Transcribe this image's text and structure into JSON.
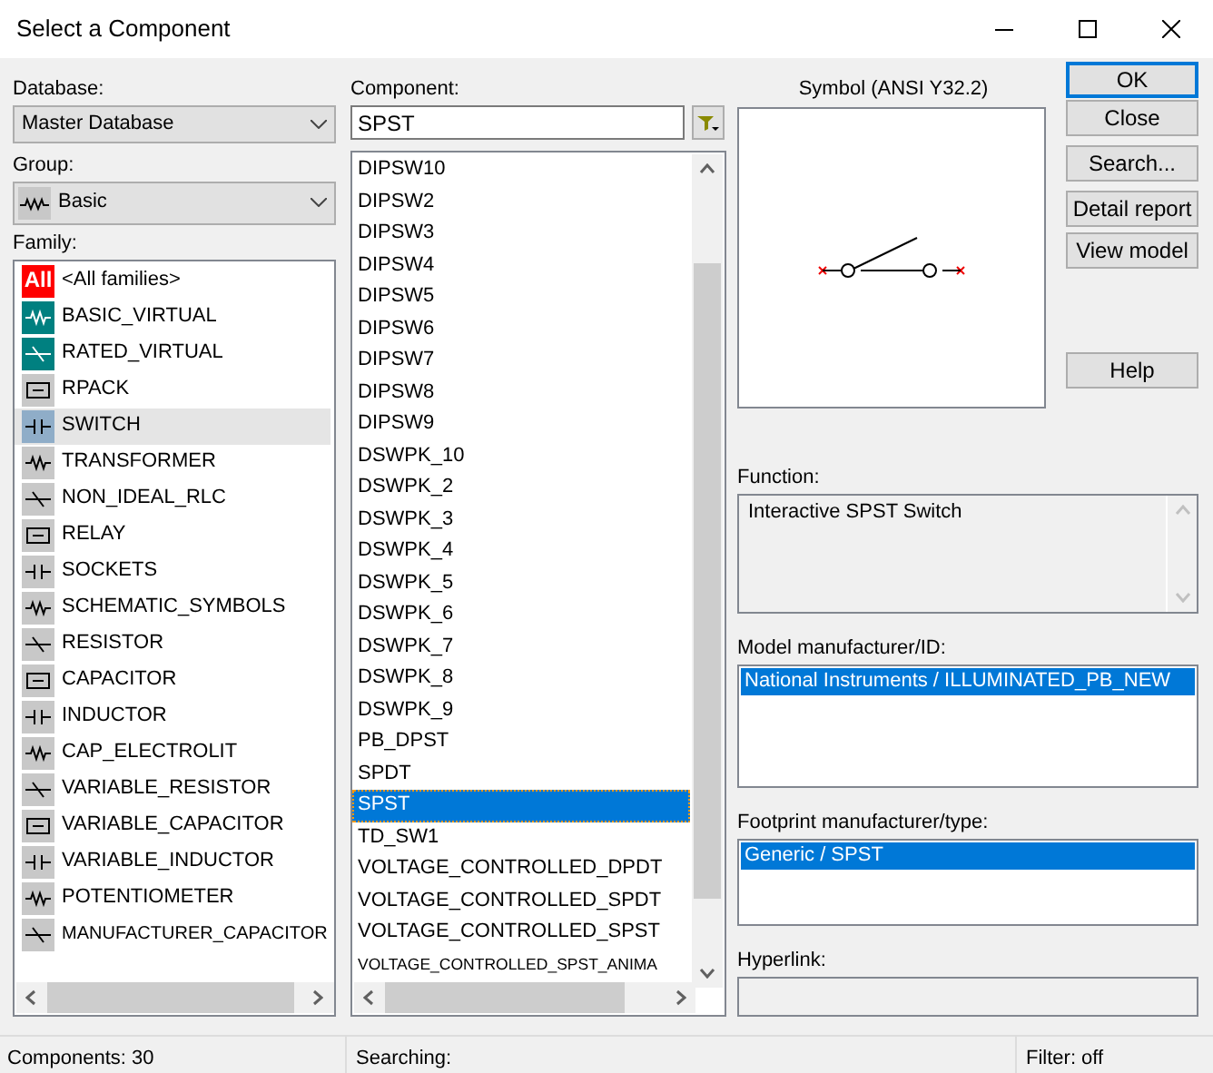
{
  "window": {
    "title": "Select a Component"
  },
  "database": {
    "label": "Database:",
    "value": "Master Database"
  },
  "group": {
    "label": "Group:",
    "value": "Basic"
  },
  "family": {
    "label": "Family:",
    "items": [
      {
        "name": "<All families>",
        "icon_text": "All",
        "color": "#ff0000",
        "selected": false
      },
      {
        "name": "BASIC_VIRTUAL",
        "color": "#008080",
        "selected": false
      },
      {
        "name": "RATED_VIRTUAL",
        "color": "#008080",
        "selected": false
      },
      {
        "name": "RPACK",
        "selected": false
      },
      {
        "name": "SWITCH",
        "selected": true
      },
      {
        "name": "TRANSFORMER",
        "selected": false
      },
      {
        "name": "NON_IDEAL_RLC",
        "selected": false
      },
      {
        "name": "RELAY",
        "selected": false
      },
      {
        "name": "SOCKETS",
        "selected": false
      },
      {
        "name": "SCHEMATIC_SYMBOLS",
        "selected": false
      },
      {
        "name": "RESISTOR",
        "selected": false
      },
      {
        "name": "CAPACITOR",
        "selected": false
      },
      {
        "name": "INDUCTOR",
        "selected": false
      },
      {
        "name": "CAP_ELECTROLIT",
        "selected": false
      },
      {
        "name": "VARIABLE_RESISTOR",
        "selected": false
      },
      {
        "name": "VARIABLE_CAPACITOR",
        "selected": false
      },
      {
        "name": "VARIABLE_INDUCTOR",
        "selected": false
      },
      {
        "name": "POTENTIOMETER",
        "selected": false
      },
      {
        "name": "MANUFACTURER_CAPACITOR",
        "selected": false
      }
    ]
  },
  "component": {
    "label": "Component:",
    "value": "SPST",
    "items": [
      {
        "name": "DIPSW10",
        "selected": false
      },
      {
        "name": "DIPSW2",
        "selected": false
      },
      {
        "name": "DIPSW3",
        "selected": false
      },
      {
        "name": "DIPSW4",
        "selected": false
      },
      {
        "name": "DIPSW5",
        "selected": false
      },
      {
        "name": "DIPSW6",
        "selected": false
      },
      {
        "name": "DIPSW7",
        "selected": false
      },
      {
        "name": "DIPSW8",
        "selected": false
      },
      {
        "name": "DIPSW9",
        "selected": false
      },
      {
        "name": "DSWPK_10",
        "selected": false
      },
      {
        "name": "DSWPK_2",
        "selected": false
      },
      {
        "name": "DSWPK_3",
        "selected": false
      },
      {
        "name": "DSWPK_4",
        "selected": false
      },
      {
        "name": "DSWPK_5",
        "selected": false
      },
      {
        "name": "DSWPK_6",
        "selected": false
      },
      {
        "name": "DSWPK_7",
        "selected": false
      },
      {
        "name": "DSWPK_8",
        "selected": false
      },
      {
        "name": "DSWPK_9",
        "selected": false
      },
      {
        "name": "PB_DPST",
        "selected": false
      },
      {
        "name": "SPDT",
        "selected": false
      },
      {
        "name": "SPST",
        "selected": true
      },
      {
        "name": "TD_SW1",
        "selected": false
      },
      {
        "name": "VOLTAGE_CONTROLLED_DPDT",
        "selected": false
      },
      {
        "name": "VOLTAGE_CONTROLLED_SPDT",
        "selected": false
      },
      {
        "name": "VOLTAGE_CONTROLLED_SPST",
        "selected": false
      },
      {
        "name": "VOLTAGE_CONTROLLED_SPST_ANIMA",
        "selected": false
      }
    ]
  },
  "symbol": {
    "title": "Symbol (ANSI Y32.2)"
  },
  "buttons": [
    {
      "label": "OK",
      "default": true
    },
    {
      "label": "Close",
      "default": false
    },
    {
      "label": "Search...",
      "default": false
    },
    {
      "label": "Detail report",
      "default": false
    },
    {
      "label": "View model",
      "default": false
    },
    {
      "label": "Help",
      "default": false
    }
  ],
  "function": {
    "label": "Function:",
    "value": "Interactive SPST Switch"
  },
  "model": {
    "label": "Model manufacturer/ID:",
    "items": [
      {
        "name": "National Instruments / ILLUMINATED_PB_NEW",
        "selected": true
      }
    ]
  },
  "footprint": {
    "label": "Footprint manufacturer/type:",
    "items": [
      {
        "name": "Generic / SPST",
        "selected": true
      }
    ]
  },
  "hyperlink": {
    "label": "Hyperlink:"
  },
  "status_bar": [
    "Components: 30",
    "Searching:",
    "Filter: off"
  ]
}
